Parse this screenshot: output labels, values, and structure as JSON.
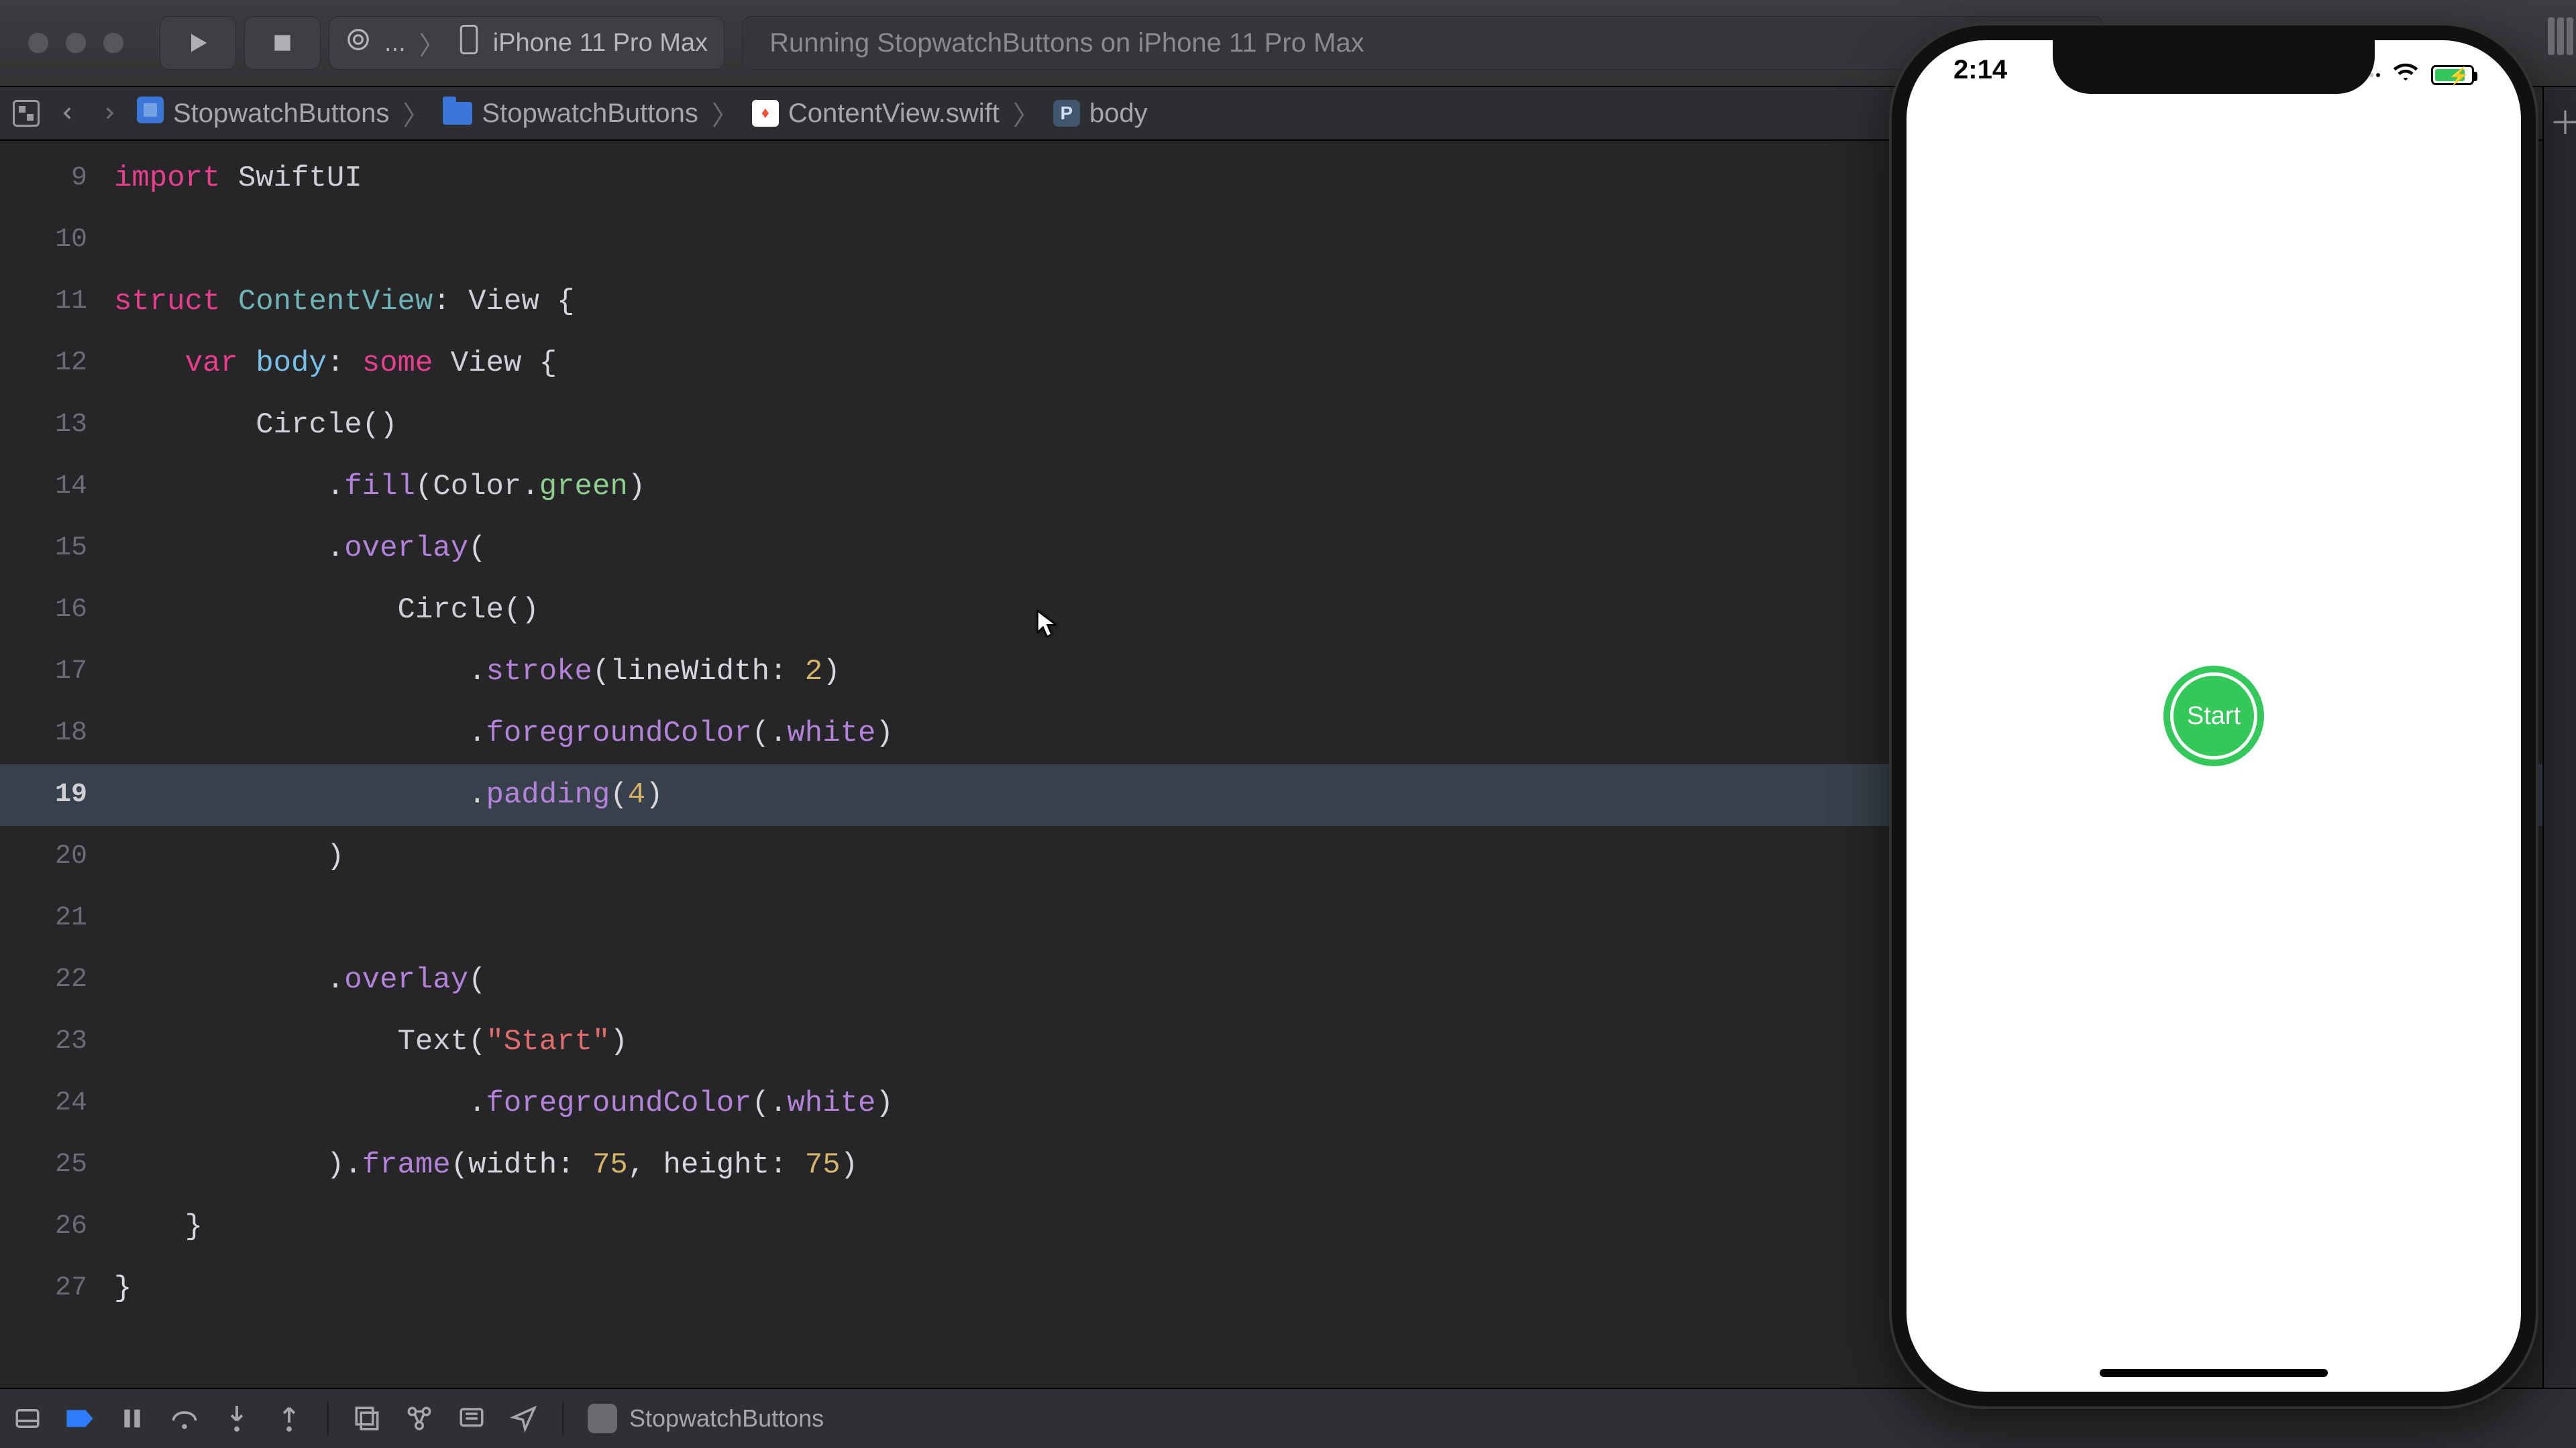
{
  "toolbar": {
    "scheme_app": "...",
    "scheme_device": "iPhone 11 Pro Max",
    "status": "Running StopwatchButtons on iPhone 11 Pro Max"
  },
  "jumpbar": {
    "project": "StopwatchButtons",
    "group": "StopwatchButtons",
    "file": "ContentView.swift",
    "symbol": "body",
    "symbol_badge": "P"
  },
  "editor": {
    "highlighted_line": 19,
    "lines": [
      {
        "n": 9,
        "tokens": [
          [
            "kw",
            "import"
          ],
          [
            "sym",
            " "
          ],
          [
            "type",
            "SwiftUI"
          ]
        ]
      },
      {
        "n": 10,
        "tokens": []
      },
      {
        "n": 11,
        "tokens": [
          [
            "kw",
            "struct"
          ],
          [
            "sym",
            " "
          ],
          [
            "typeTeal",
            "ContentView"
          ],
          [
            "sym",
            ": "
          ],
          [
            "type",
            "View"
          ],
          [
            "sym",
            " {"
          ]
        ]
      },
      {
        "n": 12,
        "tokens": [
          [
            "sym",
            "    "
          ],
          [
            "kw",
            "var"
          ],
          [
            "sym",
            " "
          ],
          [
            "id",
            "body"
          ],
          [
            "sym",
            ": "
          ],
          [
            "kw",
            "some"
          ],
          [
            "sym",
            " "
          ],
          [
            "type",
            "View"
          ],
          [
            "sym",
            " {"
          ]
        ]
      },
      {
        "n": 13,
        "tokens": [
          [
            "sym",
            "        "
          ],
          [
            "type",
            "Circle"
          ],
          [
            "sym",
            "()"
          ]
        ]
      },
      {
        "n": 14,
        "tokens": [
          [
            "sym",
            "            ."
          ],
          [
            "mod",
            "fill"
          ],
          [
            "sym",
            "("
          ],
          [
            "type",
            "Color"
          ],
          [
            "sym",
            "."
          ],
          [
            "green",
            "green"
          ],
          [
            "sym",
            ")"
          ]
        ]
      },
      {
        "n": 15,
        "tokens": [
          [
            "sym",
            "            ."
          ],
          [
            "mod",
            "overlay"
          ],
          [
            "sym",
            "("
          ]
        ]
      },
      {
        "n": 16,
        "tokens": [
          [
            "sym",
            "                "
          ],
          [
            "type",
            "Circle"
          ],
          [
            "sym",
            "()"
          ]
        ]
      },
      {
        "n": 17,
        "tokens": [
          [
            "sym",
            "                    ."
          ],
          [
            "mod",
            "stroke"
          ],
          [
            "sym",
            "(lineWidth: "
          ],
          [
            "num",
            "2"
          ],
          [
            "sym",
            ")"
          ]
        ]
      },
      {
        "n": 18,
        "tokens": [
          [
            "sym",
            "                    ."
          ],
          [
            "mod",
            "foregroundColor"
          ],
          [
            "sym",
            "(."
          ],
          [
            "enum",
            "white"
          ],
          [
            "sym",
            ")"
          ]
        ]
      },
      {
        "n": 19,
        "tokens": [
          [
            "sym",
            "                    ."
          ],
          [
            "mod",
            "padding"
          ],
          [
            "sym",
            "("
          ],
          [
            "num",
            "4"
          ],
          [
            "sym",
            ")"
          ]
        ]
      },
      {
        "n": 20,
        "tokens": [
          [
            "sym",
            "            )"
          ]
        ]
      },
      {
        "n": 21,
        "tokens": []
      },
      {
        "n": 22,
        "tokens": [
          [
            "sym",
            "            ."
          ],
          [
            "mod",
            "overlay"
          ],
          [
            "sym",
            "("
          ]
        ]
      },
      {
        "n": 23,
        "tokens": [
          [
            "sym",
            "                "
          ],
          [
            "type",
            "Text"
          ],
          [
            "sym",
            "("
          ],
          [
            "str",
            "\"Start\""
          ],
          [
            "sym",
            ")"
          ]
        ]
      },
      {
        "n": 24,
        "tokens": [
          [
            "sym",
            "                    ."
          ],
          [
            "mod",
            "foregroundColor"
          ],
          [
            "sym",
            "(."
          ],
          [
            "enum",
            "white"
          ],
          [
            "sym",
            ")"
          ]
        ]
      },
      {
        "n": 25,
        "tokens": [
          [
            "sym",
            "            )."
          ],
          [
            "mod",
            "frame"
          ],
          [
            "sym",
            "(width: "
          ],
          [
            "num",
            "75"
          ],
          [
            "sym",
            ", height: "
          ],
          [
            "num",
            "75"
          ],
          [
            "sym",
            ")"
          ]
        ]
      },
      {
        "n": 26,
        "tokens": [
          [
            "sym",
            "    }"
          ]
        ]
      },
      {
        "n": 27,
        "tokens": [
          [
            "sym",
            "}"
          ]
        ]
      }
    ]
  },
  "debugbar": {
    "process": "StopwatchButtons"
  },
  "simulator": {
    "time": "2:14",
    "button_label": "Start"
  }
}
